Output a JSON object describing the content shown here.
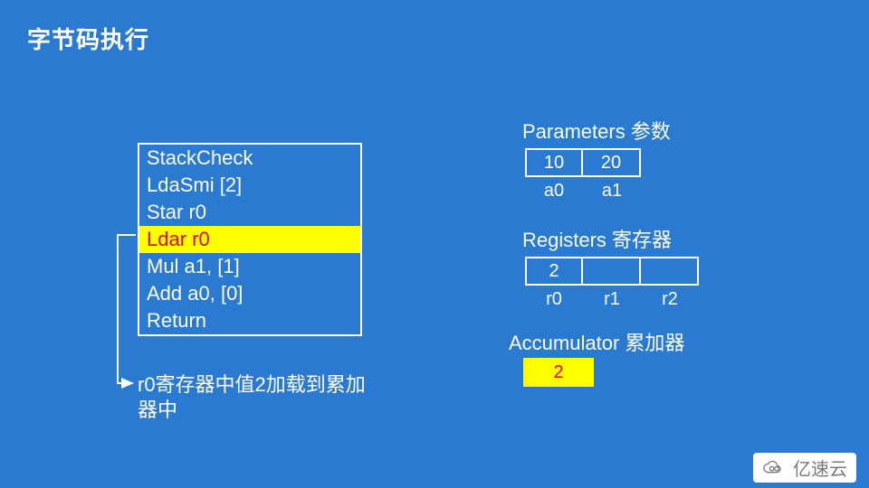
{
  "title": "字节码执行",
  "bytecode": {
    "lines": [
      "StackCheck",
      "LdaSmi [2]",
      "Star r0",
      "Ldar r0",
      "Mul a1, [1]",
      "Add a0, [0]",
      "Return"
    ],
    "highlight_index": 3
  },
  "caption": "r0寄存器中值2加载到累加器中",
  "parameters": {
    "label": "Parameters 参数",
    "cells": [
      "10",
      "20"
    ],
    "names": [
      "a0",
      "a1"
    ]
  },
  "registers": {
    "label": "Registers 寄存器",
    "cells": [
      "2",
      "",
      ""
    ],
    "names": [
      "r0",
      "r1",
      "r2"
    ]
  },
  "accumulator": {
    "label": "Accumulator 累加器",
    "value": "2"
  },
  "watermark": "亿速云",
  "colors": {
    "bg": "#2a7ad2",
    "highlight_bg": "#ffff00",
    "highlight_fg": "#e30613",
    "border": "#ffffff"
  }
}
